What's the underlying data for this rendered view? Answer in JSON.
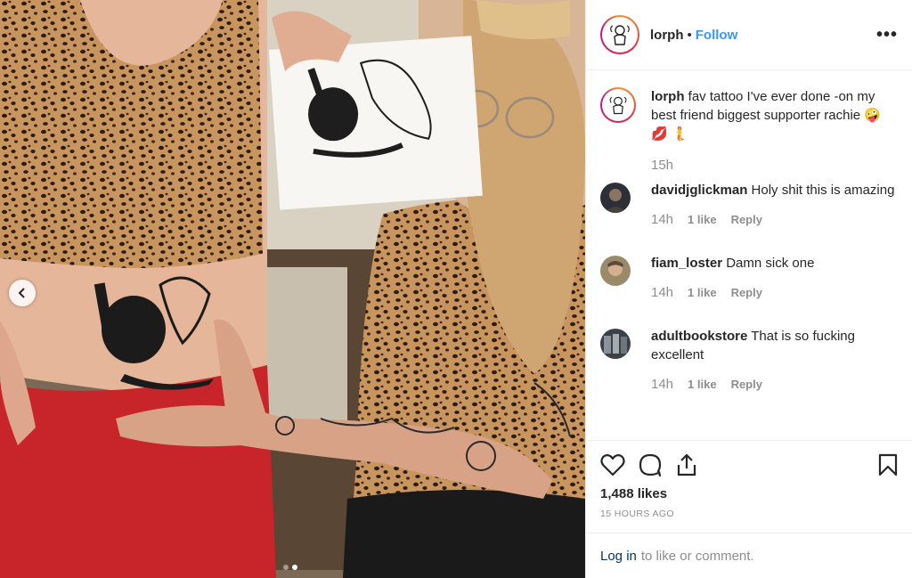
{
  "post": {
    "username": "lorph",
    "separator": "•",
    "follow_label": "Follow",
    "more_label": "•••"
  },
  "caption": {
    "username": "lorph",
    "text": "fav tattoo I've ever done -on my best friend biggest supporter rachie 🤪 💋 🧜",
    "time": "15h"
  },
  "comments": [
    {
      "username": "davidjglickman",
      "text": "Holy shit this is amazing",
      "time": "14h",
      "likes": "1 like",
      "reply": "Reply"
    },
    {
      "username": "fiam_loster",
      "text": "Damn sick one",
      "time": "14h",
      "likes": "1 like",
      "reply": "Reply"
    },
    {
      "username": "adultbookstore",
      "text": "That is so fucking excellent",
      "time": "14h",
      "likes": "1 like",
      "reply": "Reply"
    }
  ],
  "actions": {
    "likes_count": "1,488 likes",
    "posted_ago": "15 HOURS AGO"
  },
  "login": {
    "link": "Log in",
    "rest": "to like or comment."
  },
  "carousel": {
    "slide_count": 2,
    "active_index": 1
  }
}
